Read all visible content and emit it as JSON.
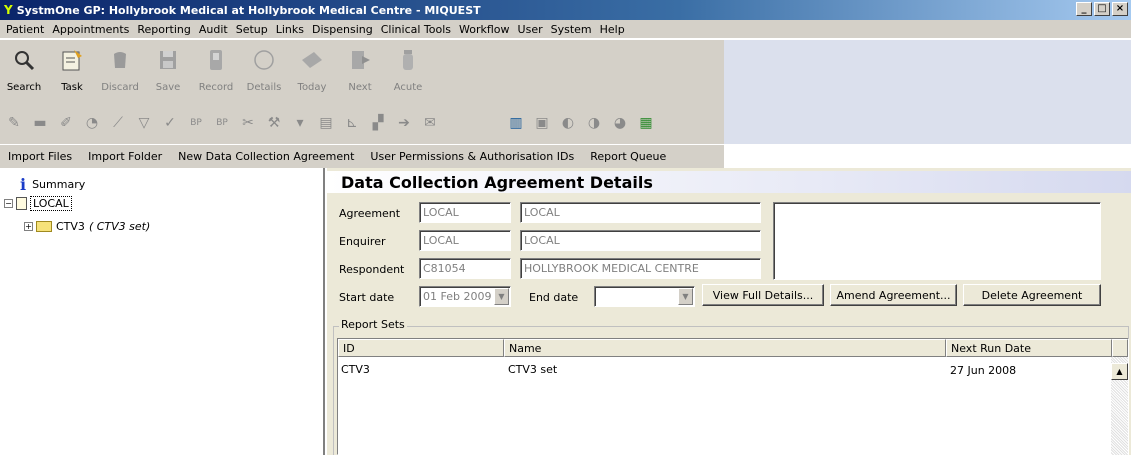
{
  "window": {
    "title": "SystmOne GP: Hollybrook Medical at Hollybrook Medical Centre - MIQUEST",
    "minimize": "_",
    "maximize": "□",
    "close": "×"
  },
  "menu": [
    "Patient",
    "Appointments",
    "Reporting",
    "Audit",
    "Setup",
    "Links",
    "Dispensing",
    "Clinical Tools",
    "Workflow",
    "User",
    "System",
    "Help"
  ],
  "toolbar": {
    "buttons": [
      {
        "label": "Search",
        "icon": "search-icon",
        "enabled": true
      },
      {
        "label": "Task",
        "icon": "task-icon",
        "enabled": true
      },
      {
        "label": "Discard",
        "icon": "discard-icon",
        "enabled": false
      },
      {
        "label": "Save",
        "icon": "save-icon",
        "enabled": false
      },
      {
        "label": "Record",
        "icon": "record-icon",
        "enabled": false
      },
      {
        "label": "Details",
        "icon": "details-icon",
        "enabled": false
      },
      {
        "label": "Today",
        "icon": "today-icon",
        "enabled": false
      },
      {
        "label": "Next",
        "icon": "next-icon",
        "enabled": false
      },
      {
        "label": "Acute",
        "icon": "acute-icon",
        "enabled": false
      }
    ]
  },
  "actions": [
    "Import Files",
    "Import Folder",
    "New Data Collection Agreement",
    "User Permissions & Authorisation IDs",
    "Report Queue"
  ],
  "tree": {
    "summary": "Summary",
    "local": "LOCAL",
    "ctv3": "CTV3",
    "ctv3_note": "( CTV3 set)"
  },
  "details": {
    "header": "Data Collection Agreement Details",
    "agreement_label": "Agreement",
    "agreement_code": "LOCAL",
    "agreement_name": "LOCAL",
    "enquirer_label": "Enquirer",
    "enquirer_code": "LOCAL",
    "enquirer_name": "LOCAL",
    "respondent_label": "Respondent",
    "respondent_code": "C81054",
    "respondent_name": "HOLLYBROOK MEDICAL CENTRE",
    "start_label": "Start date",
    "start_value": "01 Feb 2009",
    "end_label": "End date",
    "end_value": "",
    "view_btn": "View Full Details...",
    "amend_btn": "Amend Agreement...",
    "delete_btn": "Delete Agreement"
  },
  "report_sets": {
    "title": "Report Sets",
    "columns": [
      "ID",
      "Name",
      "Next Run Date"
    ],
    "rows": [
      {
        "id": "CTV3",
        "name": "CTV3 set",
        "next_run": "27 Jun 2008"
      }
    ]
  }
}
